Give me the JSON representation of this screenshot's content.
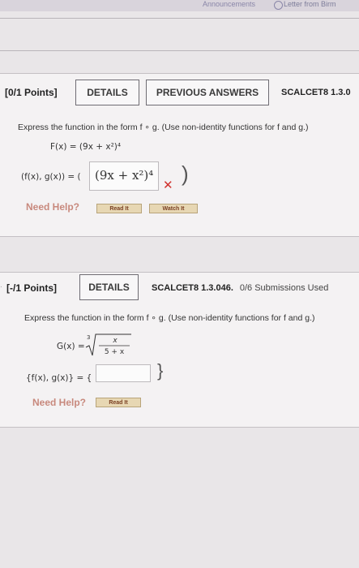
{
  "topbar": {
    "tab_announcements": "Announcements",
    "tab_letter": "Letter from Birm"
  },
  "q1": {
    "points": "[0/1 Points]",
    "details_label": "DETAILS",
    "prev_answers_label": "PREVIOUS ANSWERS",
    "code": "SCALCET8 1.3.0",
    "prompt": "Express the function in the form f ∘ g. (Use non-identity functions for f and g.)",
    "function_def": "F(x) = (9x + x²)⁴",
    "answer_label": "(f(x), g(x)) = (",
    "answer_value": "(9x + x²)⁴",
    "answer_close": ")",
    "need_help": "Need Help?",
    "read_it": "Read It",
    "watch_it": "Watch It"
  },
  "q2": {
    "points": "[-/1 Points]",
    "details_label": "DETAILS",
    "code": "SCALCET8 1.3.046.",
    "submissions": "0/6 Submissions Used",
    "prompt": "Express the function in the form f ∘ g. (Use non-identity functions for f and g.)",
    "function_lhs": "G(x) =",
    "root_index": "3",
    "numerator": "x",
    "denominator": "5 + x",
    "answer_label": "{f(x), g(x)} = {",
    "answer_close": "}",
    "need_help": "Need Help?",
    "read_it": "Read It"
  },
  "colors": {
    "wrong": "#d0312d",
    "help_text": "#c8897d",
    "help_button": "#e7d7b3"
  }
}
